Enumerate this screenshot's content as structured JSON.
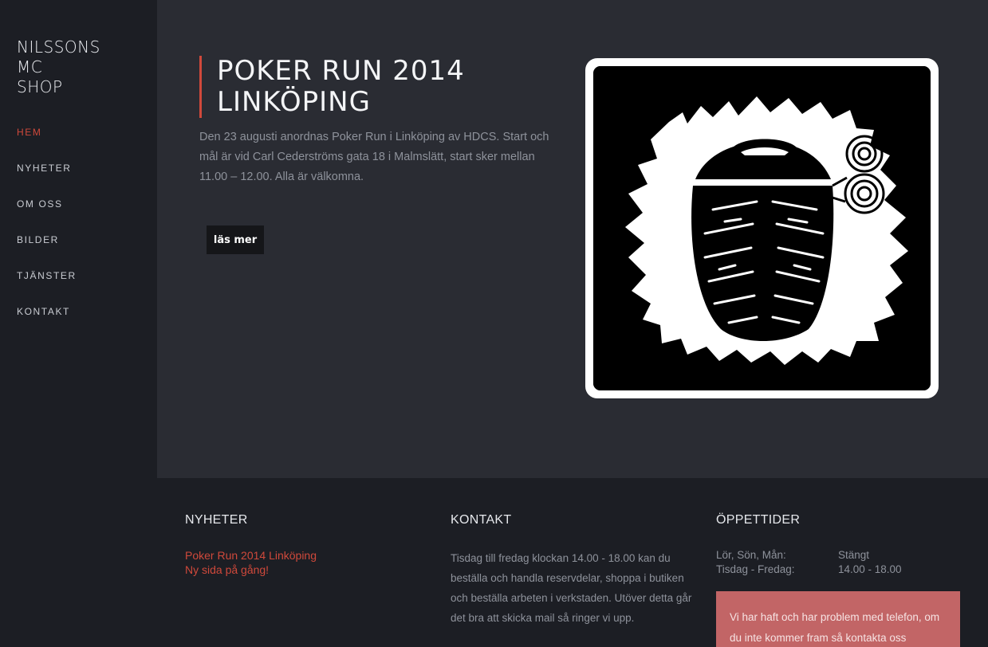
{
  "brand": {
    "line1": "NILSSONS",
    "line2": "MC",
    "line3": "SHOP"
  },
  "nav": {
    "items": [
      {
        "label": "HEM",
        "active": true
      },
      {
        "label": "NYHETER"
      },
      {
        "label": "OM OSS"
      },
      {
        "label": "BILDER"
      },
      {
        "label": "TJÄNSTER"
      },
      {
        "label": "KONTAKT"
      }
    ]
  },
  "post": {
    "title_line1": "POKER RUN 2014",
    "title_line2": "LINKÖPING",
    "body": "Den 23 augusti anordnas Poker Run i Linköping av HDCS. Start och mål är vid Carl Cederströms gata 18 i Malmslätt, start sker mellan 11.00 – 12.00. Alla är välkomna.",
    "read_more": "läs mer",
    "image_icon": "motorcycle-tire-logo-icon"
  },
  "footer": {
    "news": {
      "heading": "NYHETER",
      "items": [
        "Poker Run 2014 Linköping",
        "Ny sida på gång!"
      ]
    },
    "contact": {
      "heading": "KONTAKT",
      "text": "Tisdag till fredag klockan 14.00 - 18.00 kan du beställa och handla reservdelar, shoppa i butiken och beställa arbeten i verkstaden. Utöver detta går det bra att skicka mail så ringer vi upp."
    },
    "hours": {
      "heading": "ÖPPETTIDER",
      "rows": [
        {
          "day": "Lör, Sön, Mån:",
          "time": "Stängt"
        },
        {
          "day": "Tisdag - Fredag:",
          "time": "14.00 - 18.00"
        }
      ],
      "notice": "Vi har haft och har problem med telefon, om du inte kommer fram så kontakta oss vänligen via"
    }
  },
  "colors": {
    "accent": "#d0493b",
    "notice_bg": "#c26566",
    "main_bg": "#2a2c33",
    "sidebar_bg": "#1c1e24"
  }
}
